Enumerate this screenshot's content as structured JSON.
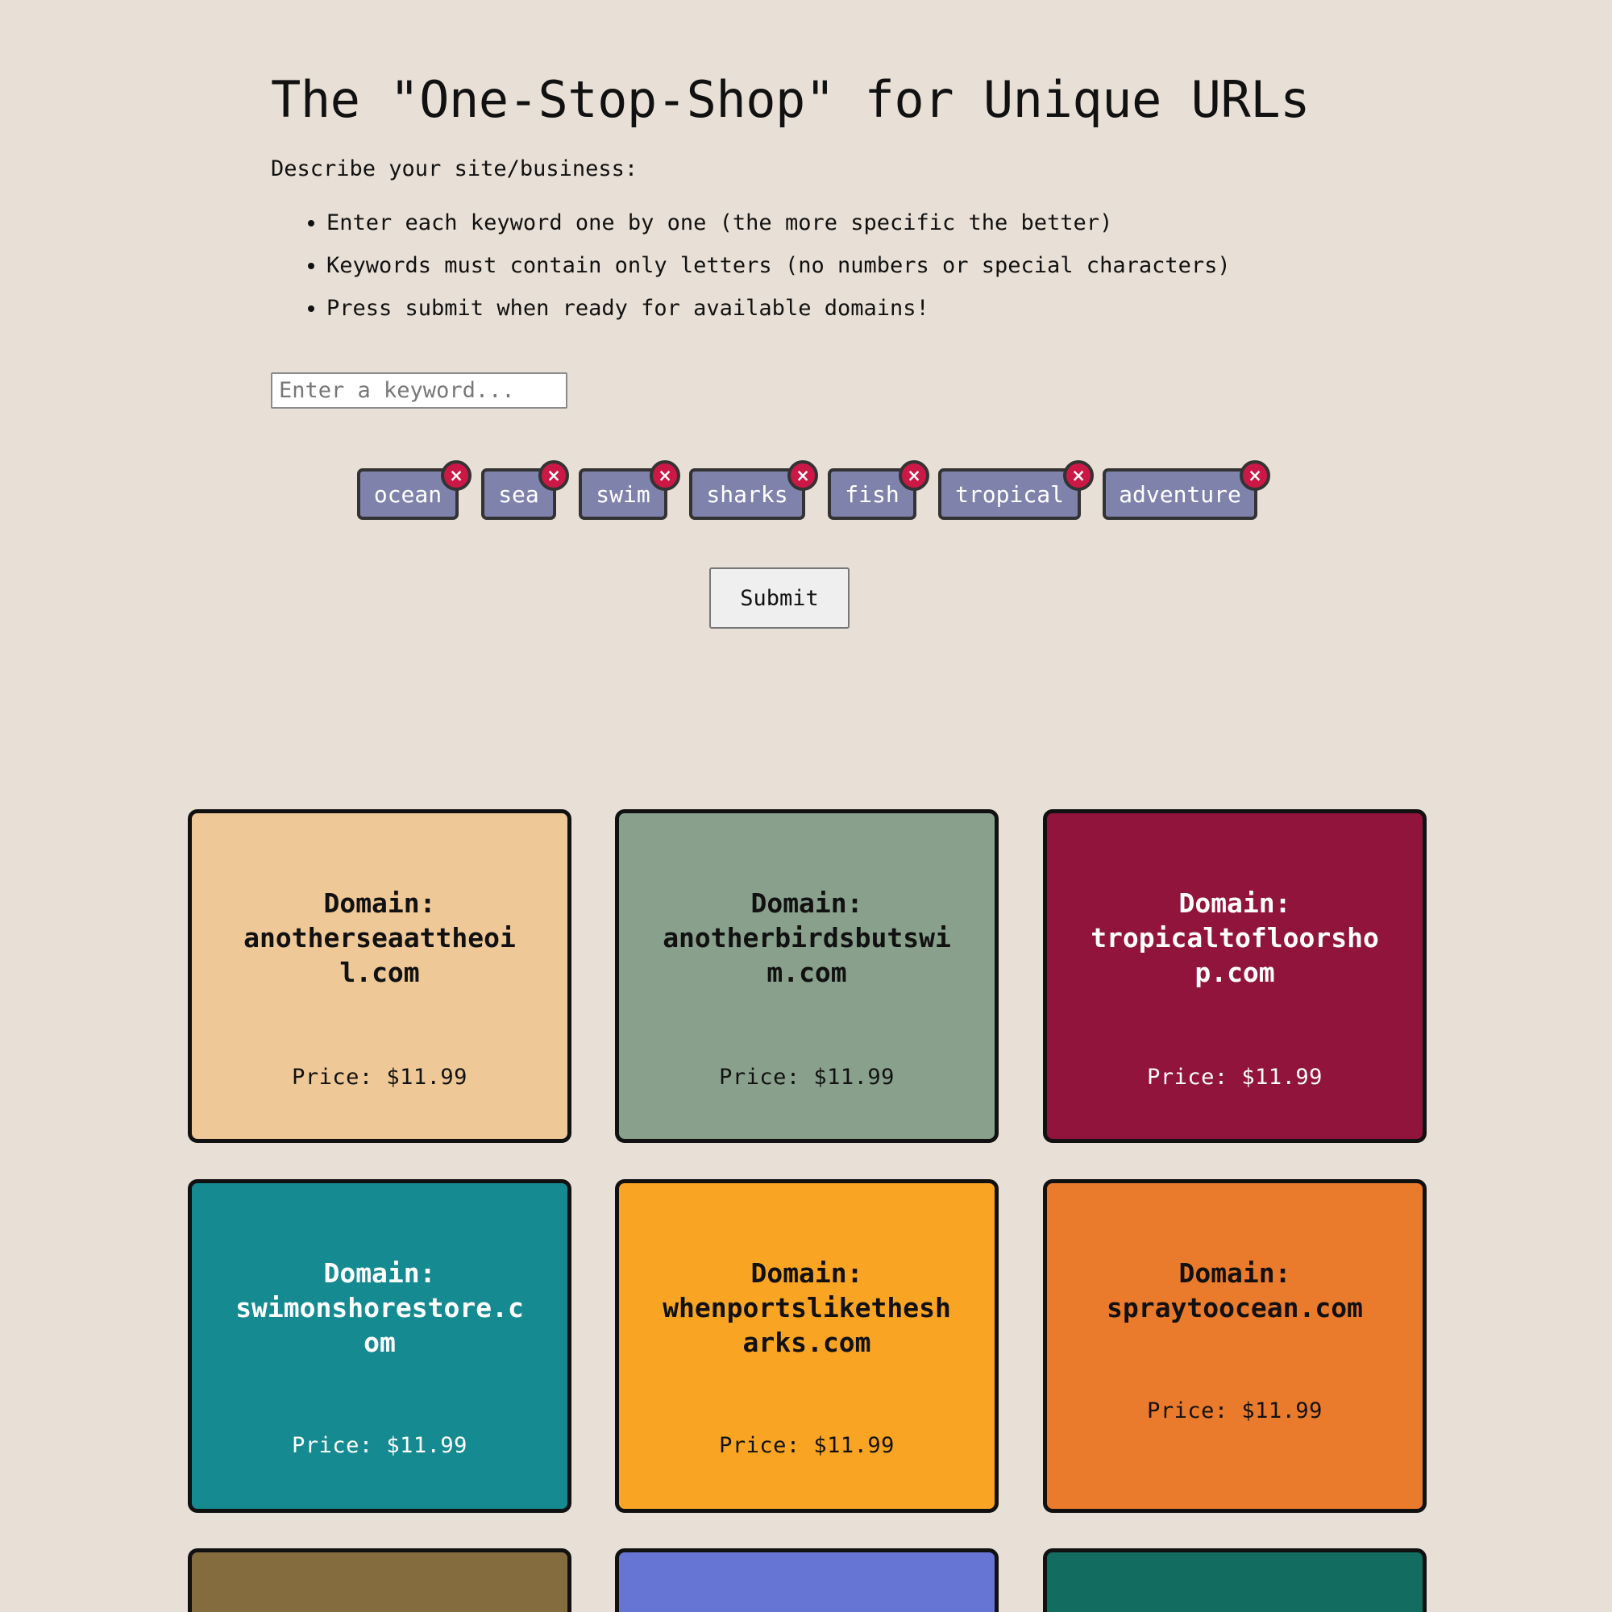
{
  "page": {
    "title": "The \"One-Stop-Shop\" for Unique URLs",
    "describe_label": "Describe your site/business:",
    "instructions": [
      "Enter each keyword one by one (the more specific the better)",
      "Keywords must contain only letters (no numbers or special characters)",
      "Press submit when ready for available domains!"
    ],
    "keyword_input": {
      "placeholder": "Enter a keyword...",
      "value": ""
    },
    "tags": [
      {
        "label": "ocean"
      },
      {
        "label": "sea"
      },
      {
        "label": "swim"
      },
      {
        "label": "sharks"
      },
      {
        "label": "fish"
      },
      {
        "label": "tropical"
      },
      {
        "label": "adventure"
      }
    ],
    "tag_remove_glyph": "×",
    "submit_label": "Submit"
  },
  "results": [
    {
      "domain_label": "Domain:",
      "domain": "anotherseaattheoil.com",
      "price": "Price: $11.99",
      "color": "#efc897"
    },
    {
      "domain_label": "Domain:",
      "domain": "anotherbirdsbutswim.com",
      "price": "Price: $11.99",
      "color": "#89a18c"
    },
    {
      "domain_label": "Domain:",
      "domain": "tropicaltofloorshop.com",
      "price": "Price: $11.99",
      "color": "#90143b"
    },
    {
      "domain_label": "Domain:",
      "domain": "swimonshorestore.com",
      "price": "Price: $11.99",
      "color": "#158a91"
    },
    {
      "domain_label": "Domain:",
      "domain": "whenportslikethesharks.com",
      "price": "Price: $11.99",
      "color": "#faa424"
    },
    {
      "domain_label": "Domain:",
      "domain": "spraytoocean.com",
      "price": "Price: $11.99",
      "color": "#ea7a2c"
    },
    {
      "domain_label": "",
      "domain": "",
      "price": "",
      "color": "#846c3f"
    },
    {
      "domain_label": "",
      "domain": "",
      "price": "",
      "color": "#6674d3"
    },
    {
      "domain_label": "",
      "domain": "",
      "price": "",
      "color": "#126d60"
    }
  ]
}
